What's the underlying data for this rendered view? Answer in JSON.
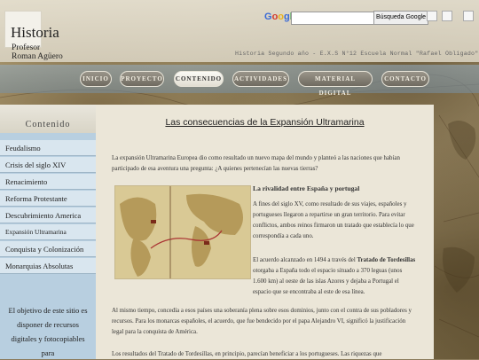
{
  "header": {
    "site_title": "Historia",
    "site_subtitle_line1": "Profesor",
    "site_subtitle_line2": "Roman Agüero",
    "google_label": "Google",
    "search_placeholder": "",
    "search_button": "Búsqueda Google",
    "tagline": "Historia Segundo año - E.X.S N°12 Escuela Normal \"Rafael Obligado\""
  },
  "nav": {
    "items": [
      "INICIO",
      "PROYECTO",
      "CONTENIDO",
      "ACTIVIDADES",
      "MATERIAL DIGITAL",
      "CONTACTO"
    ],
    "active": "CONTENIDO"
  },
  "sidebar": {
    "heading": "Contenido",
    "items": [
      "Feudalismo",
      "Crisis del siglo XIV",
      "Renacimiento",
      "Reforma Protestante",
      "Descubrimiento America",
      "Expansión Ultramarina",
      "Conquista y Colonización",
      "Monarquias Absolutas"
    ],
    "blurb": "El objetivo de este sitio es disponer de recursos digitales y fotocopiables para"
  },
  "article": {
    "title": "Las consecuencias de la Expansión Ultramarina",
    "intro": "La expansión Ultramarina Europea dio como resultado un nuevo mapa del mundo y planteó a las naciones que habían participado de esa aventura una pregunta: ¿A quienes pertenecían las nuevas tierras?",
    "section_title": "La rivalidad entre España y portugal",
    "section_p1": "A fines del siglo XV, como resultado de sus viajes, españoles y portugueses llegaron a repartirse un gran territorio. Para evitar conflictos, ambos reinos firmaron un tratado que establecía lo que correspondía a cada uno.",
    "section_p2_a": "El acuerdo alcanzado en 1494 a través del ",
    "section_p2_b": "Tratado de Tordesillas",
    "section_p2_c": " otorgaba a España todo el espacio situado a 370 leguas (unos 1.600 km) al oeste de las islas Azores y dejaba a Portugal el espacio que se encontraba al este de esa línea.",
    "section_p3": "Al mismo tiempo, concedía a esos países una soberanía plena sobre esos dominios, junto con el contra de sus pobladores y recursos. Para los monarcas españoles, el acuerdo, que fue bendecido por el papa Alejandro VI, significó la justificación legal para la conquista de América.",
    "section_p4": "Los resultados del Tratado de Tordesillas, en principio, parecían beneficiar a los portugueses. Las riquezas que"
  },
  "colors": {
    "sidebar_bg": "#b8cfe0",
    "content_bg": "#ebe6d8",
    "nav_button": "#7f7a70"
  }
}
